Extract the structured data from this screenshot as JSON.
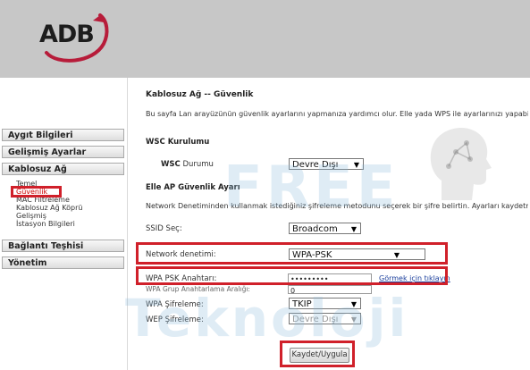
{
  "header": {
    "logo_text": "ADB"
  },
  "nav": {
    "items": [
      {
        "label": "Aygıt Bilgileri"
      },
      {
        "label": "Gelişmiş Ayarlar"
      },
      {
        "label": "Kablosuz Ağ"
      }
    ],
    "sub_items": [
      {
        "label": "Temel"
      },
      {
        "label": "Güvenlik"
      },
      {
        "label": "MAC Filtreleme"
      },
      {
        "label": "Kablosuz Ağ Köprü"
      },
      {
        "label": "Gelişmiş"
      },
      {
        "label": "İstasyon Bilgileri"
      }
    ],
    "items2": [
      {
        "label": "Bağlantı Teşhisi"
      },
      {
        "label": "Yönetim"
      }
    ]
  },
  "page": {
    "title": "Kablosuz Ağ -- Güvenlik",
    "intro": "Bu sayfa Lan arayüzünün güvenlik ayarlarını yapmanıza yardımcı olur. Elle yada WPS ile ayarlarınızı yapabilirsin",
    "wsc_section": "WSC Kurulumu",
    "wsc_label_bold": "WSC",
    "wsc_label_rest": "Durumu",
    "wsc_value": "Devre Dışı",
    "manual_section": "Elle AP Güvenlik Ayarı",
    "manual_desc": "Network Denetiminden kullanmak istediğiniz şifreleme metodunu seçerek bir şifre belirtin. Ayarları kaydetmek",
    "ssid_label": "SSID Seç:",
    "ssid_value": "Broadcom",
    "network_label": "Network denetimi:",
    "network_value": "WPA-PSK",
    "psk_label": "WPA PSK Anahtarı:",
    "psk_value": "•••••••••",
    "show_link": "Görmek için tıklayın",
    "group_rekey_label": "WPA Grup Anahtarlama Aralığı:",
    "group_rekey_value": "0",
    "wpa_enc_label": "WPA Şifreleme:",
    "wpa_enc_value": "TKIP",
    "wep_enc_label": "WEP Şifreleme:",
    "wep_enc_value": "Devre Dışı",
    "save_button": "Kaydet/Uygula"
  },
  "watermark": {
    "line1": "FREE",
    "line2": "Teknoloji"
  },
  "colors": {
    "header_bg": "#c7c7c7",
    "highlight": "#d0202a",
    "link": "#1a3e9c"
  }
}
